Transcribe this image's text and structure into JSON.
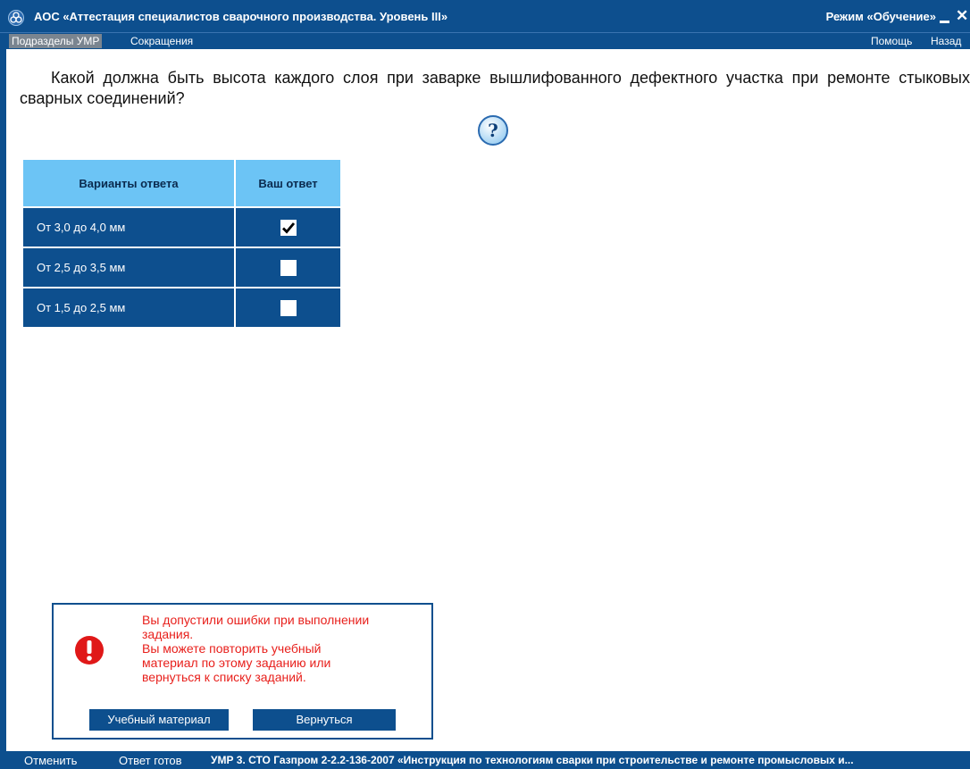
{
  "window": {
    "title": "АОС «Аттестация специалистов сварочного производства. Уровень III»",
    "mode": "Режим «Обучение»"
  },
  "menu": {
    "left": [
      "Подразделы УМР",
      "Сокращения"
    ],
    "right": [
      "Помощь",
      "Назад"
    ]
  },
  "question": {
    "text": "Какой должна быть высота каждого слоя при заварке вышлифованного дефектного участка при ремонте стыковых сварных соединений?"
  },
  "answers": {
    "headers": [
      "Варианты ответа",
      "Ваш ответ"
    ],
    "rows": [
      {
        "label": "От 3,0 до 4,0 мм",
        "checked": true
      },
      {
        "label": "От 2,5 до 3,5 мм",
        "checked": false
      },
      {
        "label": "От 1,5 до 2,5 мм",
        "checked": false
      }
    ]
  },
  "dialog": {
    "lines": [
      "Вы допустили ошибки при выполнении",
      "задания.",
      "Вы можете повторить учебный",
      "материал по этому заданию или",
      "вернуться к списку заданий."
    ],
    "buttons": {
      "study": "Учебный материал",
      "back": "Вернуться"
    }
  },
  "statusbar": {
    "cancel": "Отменить",
    "ready": "Ответ готов",
    "info": "УМР 3. СТО Газпром 2-2.2-136-2007 «Инструкция по технологиям сварки при строительстве и ремонте промысловых и..."
  },
  "colors": {
    "primary": "#0d4f8e",
    "header_cyan": "#6cc4f5",
    "error_red": "#e8201c",
    "menu_active": "#7a8590"
  },
  "icons": {
    "app": "app-logo-icon",
    "help": "question-mark-icon",
    "error": "exclamation-icon",
    "check": "checkmark-icon"
  }
}
